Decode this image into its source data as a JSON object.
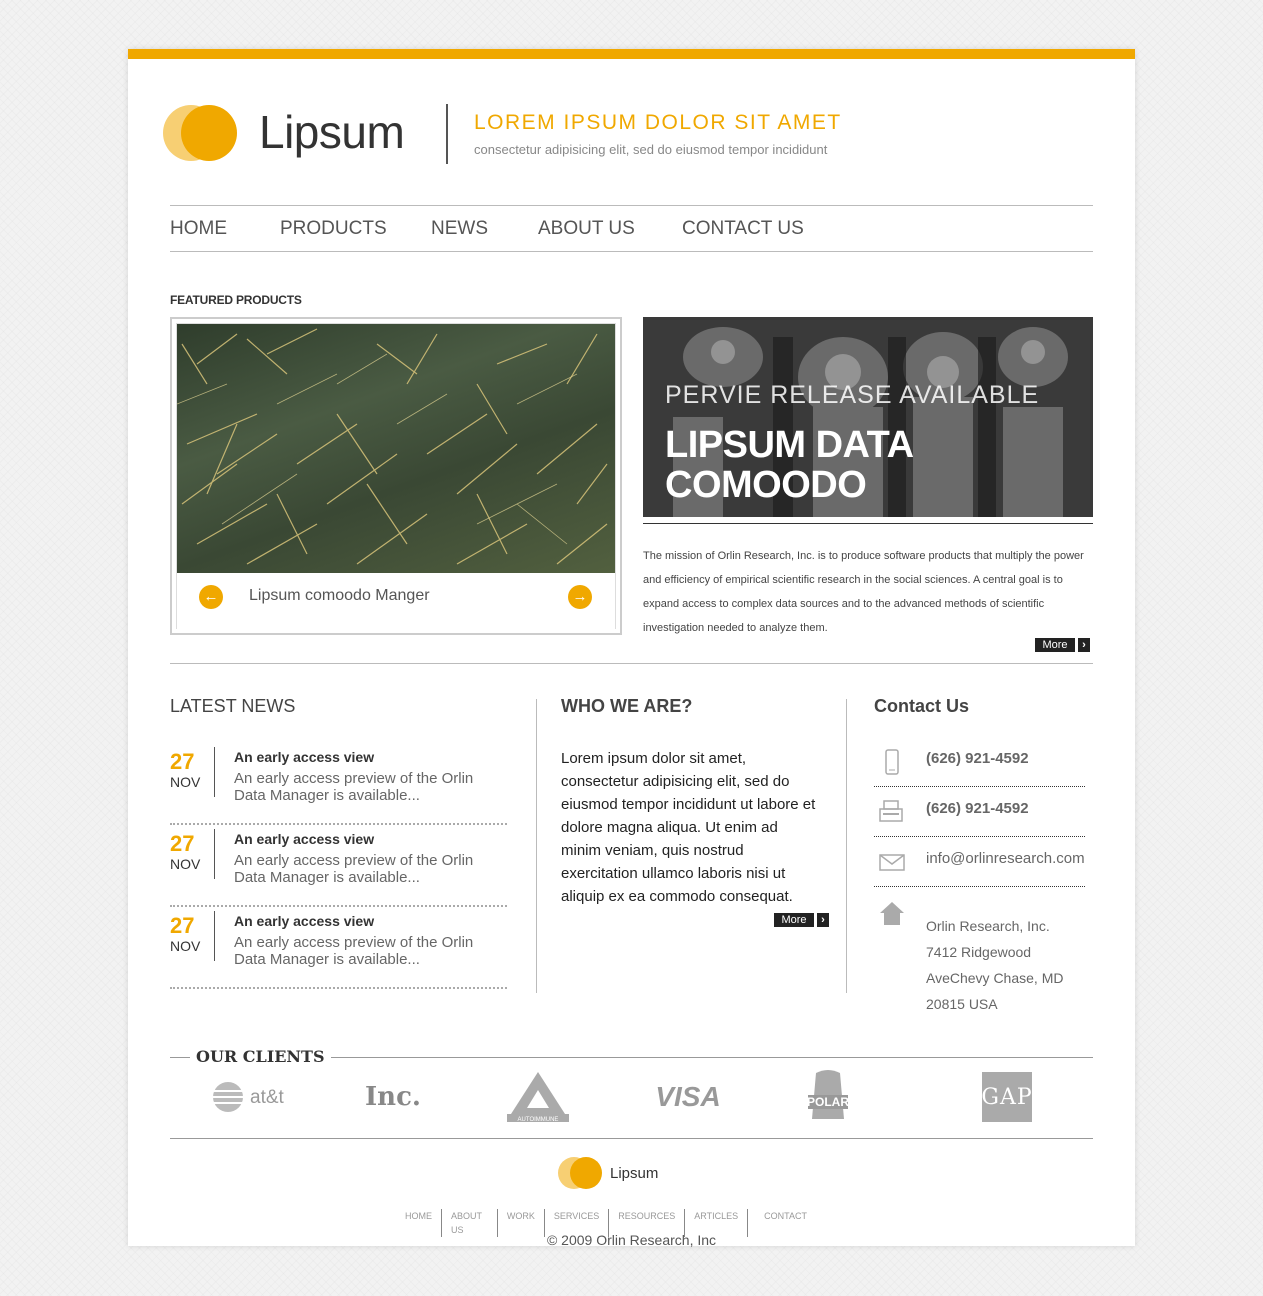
{
  "header": {
    "logo_text": "Lipsum",
    "tagline": "LOREM IPSUM DOLOR SIT AMET",
    "subtagline": "consectetur adipisicing elit, sed do eiusmod tempor incididunt"
  },
  "nav": {
    "items": [
      "HOME",
      "PRODUCTS",
      "NEWS",
      "ABOUT US",
      "CONTACT US"
    ]
  },
  "featured": {
    "label": "FEATURED PRODUCTS",
    "slider_caption": "Lipsum comoodo Manger",
    "banner_line1": "PERVIE  RELEASE  AVAILABLE",
    "banner_line2": "LIPSUM DATA",
    "banner_line3": "COMOODO",
    "mission": "The mission of Orlin Research, Inc. is to produce software products that multiply the power and efficiency of empirical scientific research in the social sciences. A central goal is to expand access to complex data sources and to the advanced methods of scientific investigation needed to analyze them.",
    "more_label": "More"
  },
  "latest_news": {
    "title": "LATEST NEWS",
    "items": [
      {
        "day": "27",
        "month": "NOV",
        "title": "An early access view",
        "desc": "An early access preview of the Orlin Data Manager is available..."
      },
      {
        "day": "27",
        "month": "NOV",
        "title": "An early access view",
        "desc": "An early access preview of the Orlin Data Manager is available..."
      },
      {
        "day": "27",
        "month": "NOV",
        "title": "An early access view",
        "desc": "An early access preview of the Orlin Data Manager is available..."
      }
    ]
  },
  "who": {
    "title": "WHO WE ARE?",
    "text": "Lorem ipsum dolor sit amet, consectetur adipisicing elit, sed do eiusmod tempor incididunt ut labore et dolore magna aliqua. Ut enim ad minim veniam, quis nostrud exercitation ullamco laboris nisi ut aliquip ex ea commodo consequat.",
    "more_label": "More"
  },
  "contact": {
    "title": "Contact Us",
    "phone": "(626) 921-4592",
    "fax": "(626) 921-4592",
    "email": "info@orlinresearch.com",
    "address_lines": [
      "Orlin Research, Inc.",
      "7412 Ridgewood",
      "AveChevy Chase, MD",
      "20815 USA"
    ]
  },
  "clients": {
    "label": "OUR CLIENTS",
    "logos": [
      "at&t",
      "Inc.",
      "AUTOIMMUNE",
      "VISA",
      "POLAR",
      "GAP"
    ]
  },
  "footer": {
    "logo_text": "Lipsum",
    "nav": [
      "HOME",
      "ABOUT US",
      "WORK",
      "SERVICES",
      "RESOURCES",
      "ARTICLES",
      "CONTACT"
    ],
    "copyright": "© 2009 Orlin Research, Inc"
  },
  "colors": {
    "accent": "#f0a800",
    "accent_light": "#f7cf73"
  }
}
